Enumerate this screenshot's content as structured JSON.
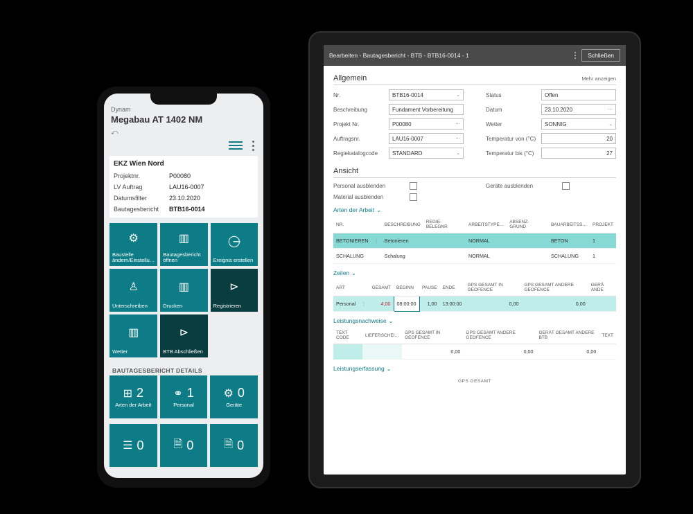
{
  "phone": {
    "app_label": "Dynam",
    "title": "Megabau AT 1402 NM",
    "site_name": "EKZ Wien Nord",
    "fields": [
      {
        "label": "Projektnr.",
        "value": "P00080"
      },
      {
        "label": "LV Auftrag",
        "value": "LAU16-0007"
      },
      {
        "label": "Datumsfilter",
        "value": "23.10.2020"
      },
      {
        "label": "Bautagesbericht",
        "value": "BTB16-0014"
      }
    ],
    "tiles": {
      "row1": [
        {
          "label": "Baustelle ändern/Einstellu…",
          "icon": "⚙⚙"
        },
        {
          "label": "Bautagesbericht öffnen",
          "icon": "▤"
        },
        {
          "label": "Ereignis erstellen",
          "icon": "📷"
        }
      ],
      "row2": [
        {
          "label": "Unterschreiben",
          "icon": "👤"
        },
        {
          "label": "Drucken",
          "icon": "▤"
        },
        {
          "label": "Registrieren",
          "icon": "▷",
          "dark": true
        }
      ],
      "row3": [
        {
          "label": "Wetter",
          "icon": "▤"
        },
        {
          "label": "BTB Abschließen",
          "icon": "▷",
          "dark": true
        }
      ]
    },
    "details_header": "BAUTAGESBERICHT DETAILS",
    "stats": {
      "row1": [
        {
          "label": "Arten der Arbeit",
          "icon": "⊞",
          "value": "2"
        },
        {
          "label": "Personal",
          "icon": "👥",
          "value": "1"
        },
        {
          "label": "Geräte",
          "icon": "⚙",
          "value": "0"
        }
      ],
      "row2": [
        {
          "label": "",
          "icon": "☰✓",
          "value": "0"
        },
        {
          "label": "",
          "icon": "🗎",
          "value": "0"
        },
        {
          "label": "",
          "icon": "🗎",
          "value": "0"
        }
      ]
    }
  },
  "tablet": {
    "top_title": "Bearbeiten - Bautagesbericht - BTB - BTB16-0014 - 1",
    "close_label": "Schließen",
    "sect_allgemein": {
      "title": "Allgemein",
      "more": "Mehr anzeigen",
      "left": [
        {
          "label": "Nr.",
          "value": "BTB16-0014",
          "dd": true
        },
        {
          "label": "Beschreibung",
          "value": "Fundament Vorbereitung"
        },
        {
          "label": "Projekt Nr.",
          "value": "P00080",
          "dd": true
        },
        {
          "label": "Auftragsnr.",
          "value": "LAU16-0007",
          "dd": true
        },
        {
          "label": "Regiekatalogcode",
          "value": "STANDARD",
          "dd": true
        }
      ],
      "right": [
        {
          "label": "Status",
          "value": "Offen"
        },
        {
          "label": "Datum",
          "value": "23.10.2020",
          "dd": true
        },
        {
          "label": "Wetter",
          "value": "SONNIG",
          "dd": true
        },
        {
          "label": "Temperatur von (°C)",
          "value": "20",
          "align": "r"
        },
        {
          "label": "Temperatur bis (°C)",
          "value": "27",
          "align": "r"
        }
      ]
    },
    "sect_ansicht": {
      "title": "Ansicht",
      "items": [
        {
          "label": "Personal ausblenden"
        },
        {
          "label": "Geräte ausblenden"
        },
        {
          "label": "Material ausblenden"
        }
      ]
    },
    "sect_arten": {
      "title": "Arten der Arbeit",
      "cols": [
        "NR.",
        "",
        "BESCHREIBUNG",
        "REGIE-BELEGNR",
        "ARBEITSTYPE…",
        "ABSENZ-GRUND",
        "BAUARBEITSS…",
        "PROJEKT"
      ],
      "rows": [
        {
          "hl": true,
          "cells": [
            "BETONIEREN",
            "⋮",
            "Betonieren",
            "",
            "NORMAL",
            "",
            "BETON",
            "1"
          ]
        },
        {
          "hl": false,
          "cells": [
            "SCHALUNG",
            "",
            "Schalung",
            "",
            "NORMAL",
            "",
            "SCHALUNG",
            "1"
          ]
        }
      ]
    },
    "sect_zeilen": {
      "title": "Zeilen",
      "cols": [
        "ART",
        "",
        "GESAMT",
        "BEGINN",
        "PAUSE",
        "ENDE",
        "GPS GESAMT IN GEOFENCE",
        "GPS GESAMT ANDERE GEOFENCE",
        "GERÄ ANDE"
      ],
      "row": {
        "cells": [
          "Personal",
          "⋮",
          "4,00",
          "08:00:00",
          "1,00",
          "13:00:00",
          "0,00",
          "0,00",
          ""
        ]
      }
    },
    "sect_nachweise": {
      "title": "Leistungsnachweise",
      "cols": [
        "TEXT CODE",
        "LIEFERSCHEI…",
        "GPS GESAMT IN GEOFENCE",
        "GPS GESAMT ANDERE GEOFENCE",
        "GERÄT GESAMT ANDERE BTB",
        "TEXT"
      ],
      "vals": [
        "",
        "",
        "0,00",
        "0,00",
        "0,00",
        ""
      ]
    },
    "sect_erfassung": {
      "title": "Leistungserfassung",
      "gps": "GPS GESAMT"
    }
  }
}
